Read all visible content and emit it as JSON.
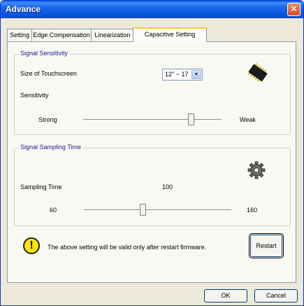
{
  "window": {
    "title": "Advance",
    "close_glyph": "✕"
  },
  "tabs": [
    {
      "label": "Setting",
      "active": false
    },
    {
      "label": "Edge Compensation",
      "active": false
    },
    {
      "label": "Linearization",
      "active": false
    },
    {
      "label": "Capacitive Setting",
      "active": true
    }
  ],
  "signal_sensitivity": {
    "group_label": "Signal Sensitivity",
    "size_label": "Size of Touchscreen",
    "size_value": "12\" ~ 17",
    "sensitivity_label": "Sensitivity",
    "min_label": "Strong",
    "max_label": "Weak",
    "slider_fraction": 0.78,
    "icon": "chip-icon"
  },
  "signal_sampling": {
    "group_label": "Signal Sampling Time",
    "sampling_label": "Sampling Time",
    "current_value": "100",
    "min_label": "60",
    "max_label": "160",
    "slider_fraction": 0.4,
    "icon": "gear-icon"
  },
  "notice": {
    "icon": "warning-icon",
    "glyph": "!",
    "message": "The above setting will be valid only after restart firmware.",
    "restart_label": "Restart"
  },
  "footer": {
    "ok_label": "OK",
    "cancel_label": "Cancel"
  },
  "colors": {
    "titlebar": "#0a54d8",
    "warning": "#ffe600",
    "active_tab_accent": "#ffc83c"
  }
}
